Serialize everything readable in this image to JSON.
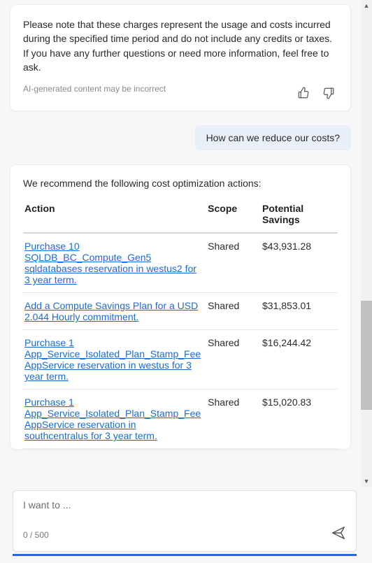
{
  "assistant_prev": {
    "note": "Please note that these charges represent the usage and costs incurred during the specified time period and do not include any credits or taxes. If you have any further questions or need more information, feel free to ask.",
    "disclaimer": "AI-generated content may be incorrect"
  },
  "user_message": "How can we reduce our costs?",
  "recommendations": {
    "intro": "We recommend the following cost optimization actions:",
    "headers": {
      "action": "Action",
      "scope": "Scope",
      "savings": "Potential Savings"
    },
    "rows": [
      {
        "action": "Purchase 10 SQLDB_BC_Compute_Gen5 sqldatabases reservation in westus2 for 3 year term.",
        "scope": "Shared",
        "savings": "$43,931.28"
      },
      {
        "action": "Add a Compute Savings Plan for a USD 2.044 Hourly commitment.",
        "scope": "Shared",
        "savings": "$31,853.01"
      },
      {
        "action": "Purchase 1 App_Service_Isolated_Plan_Stamp_Fee AppService reservation in westus for 3 year term.",
        "scope": "Shared",
        "savings": "$16,244.42"
      },
      {
        "action": "Purchase 1 App_Service_Isolated_Plan_Stamp_Fee AppService reservation in southcentralus for 3 year term.",
        "scope": "Shared",
        "savings": "$15,020.83"
      }
    ]
  },
  "input": {
    "placeholder": "I want to ...",
    "counter": "0 / 500"
  },
  "colors": {
    "link": "#1a6dd0",
    "user_bubble": "#e9eff9",
    "accent": "#2b62e3"
  }
}
